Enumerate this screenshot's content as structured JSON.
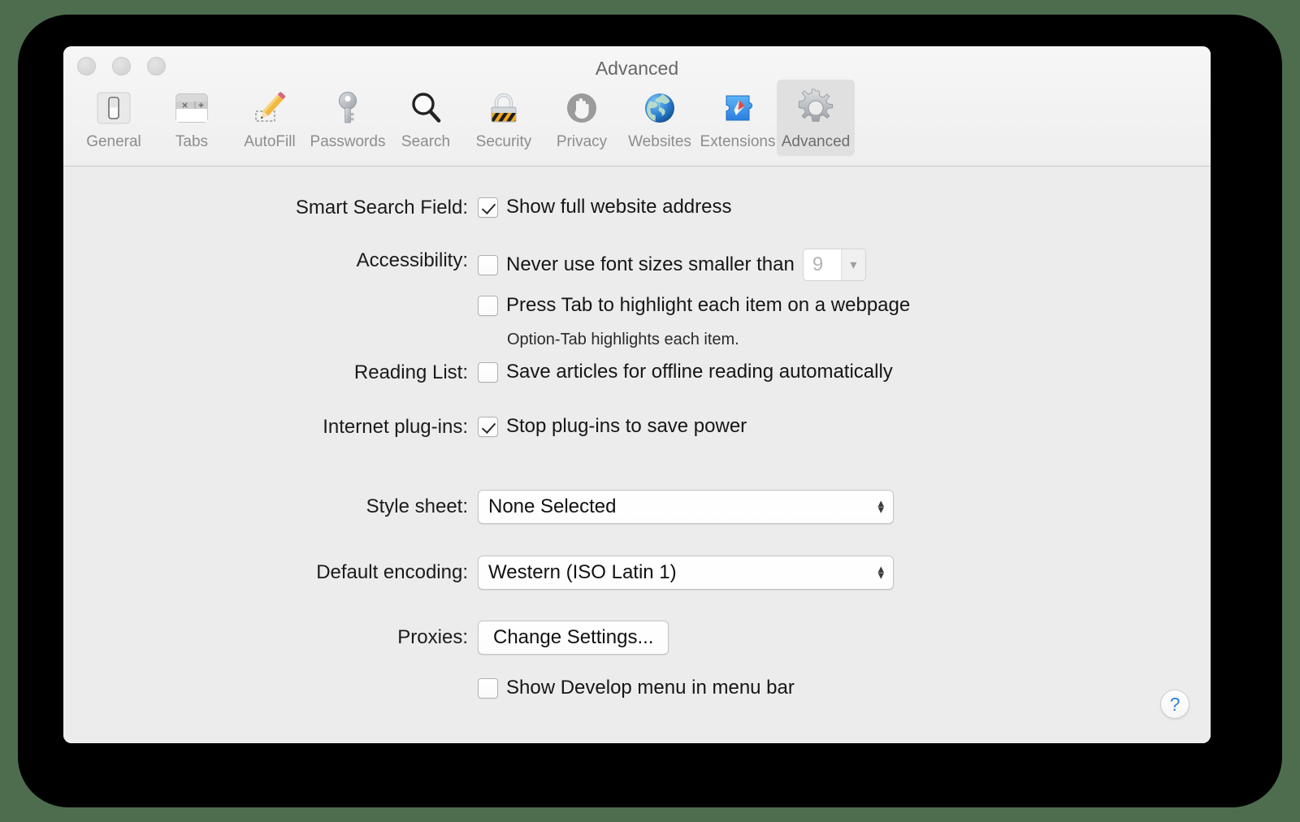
{
  "window": {
    "title": "Advanced",
    "traffic_lights": [
      "close-button",
      "minimize-button",
      "zoom-button"
    ]
  },
  "toolbar": {
    "tabs": [
      {
        "label": "General",
        "icon": "general-switch-icon",
        "selected": false
      },
      {
        "label": "Tabs",
        "icon": "tabs-window-icon",
        "selected": false
      },
      {
        "label": "AutoFill",
        "icon": "autofill-pencil-icon",
        "selected": false
      },
      {
        "label": "Passwords",
        "icon": "passwords-key-icon",
        "selected": false
      },
      {
        "label": "Search",
        "icon": "search-magnifier-icon",
        "selected": false
      },
      {
        "label": "Security",
        "icon": "security-padlock-icon",
        "selected": false
      },
      {
        "label": "Privacy",
        "icon": "privacy-hand-icon",
        "selected": false
      },
      {
        "label": "Websites",
        "icon": "websites-globe-icon",
        "selected": false
      },
      {
        "label": "Extensions",
        "icon": "extensions-puzzle-icon",
        "selected": false
      },
      {
        "label": "Advanced",
        "icon": "advanced-gear-icon",
        "selected": true
      }
    ]
  },
  "settings": {
    "smart_search": {
      "label": "Smart Search Field:",
      "checkbox_label": "Show full website address",
      "checked": true
    },
    "accessibility": {
      "label": "Accessibility:",
      "font_size_label": "Never use font sizes smaller than",
      "font_size_checked": false,
      "font_size_value": "9",
      "tab_highlight_label": "Press Tab to highlight each item on a webpage",
      "tab_highlight_checked": false,
      "hint": "Option-Tab highlights each item."
    },
    "reading_list": {
      "label": "Reading List:",
      "checkbox_label": "Save articles for offline reading automatically",
      "checked": false
    },
    "internet_plugins": {
      "label": "Internet plug-ins:",
      "checkbox_label": "Stop plug-ins to save power",
      "checked": true
    },
    "style_sheet": {
      "label": "Style sheet:",
      "value": "None Selected"
    },
    "default_encoding": {
      "label": "Default encoding:",
      "value": "Western (ISO Latin 1)"
    },
    "proxies": {
      "label": "Proxies:",
      "button_label": "Change Settings..."
    },
    "develop_menu": {
      "checkbox_label": "Show Develop menu in menu bar",
      "checked": false
    }
  },
  "help": {
    "glyph": "?",
    "name": "help-button"
  },
  "colors": {
    "desktop": "#4e6d4e",
    "window_bg": "#ececec",
    "toolbar_bg": "#f2f2f2",
    "selected_tab": "#e0e0e0",
    "help_blue": "#2d7fe0"
  }
}
